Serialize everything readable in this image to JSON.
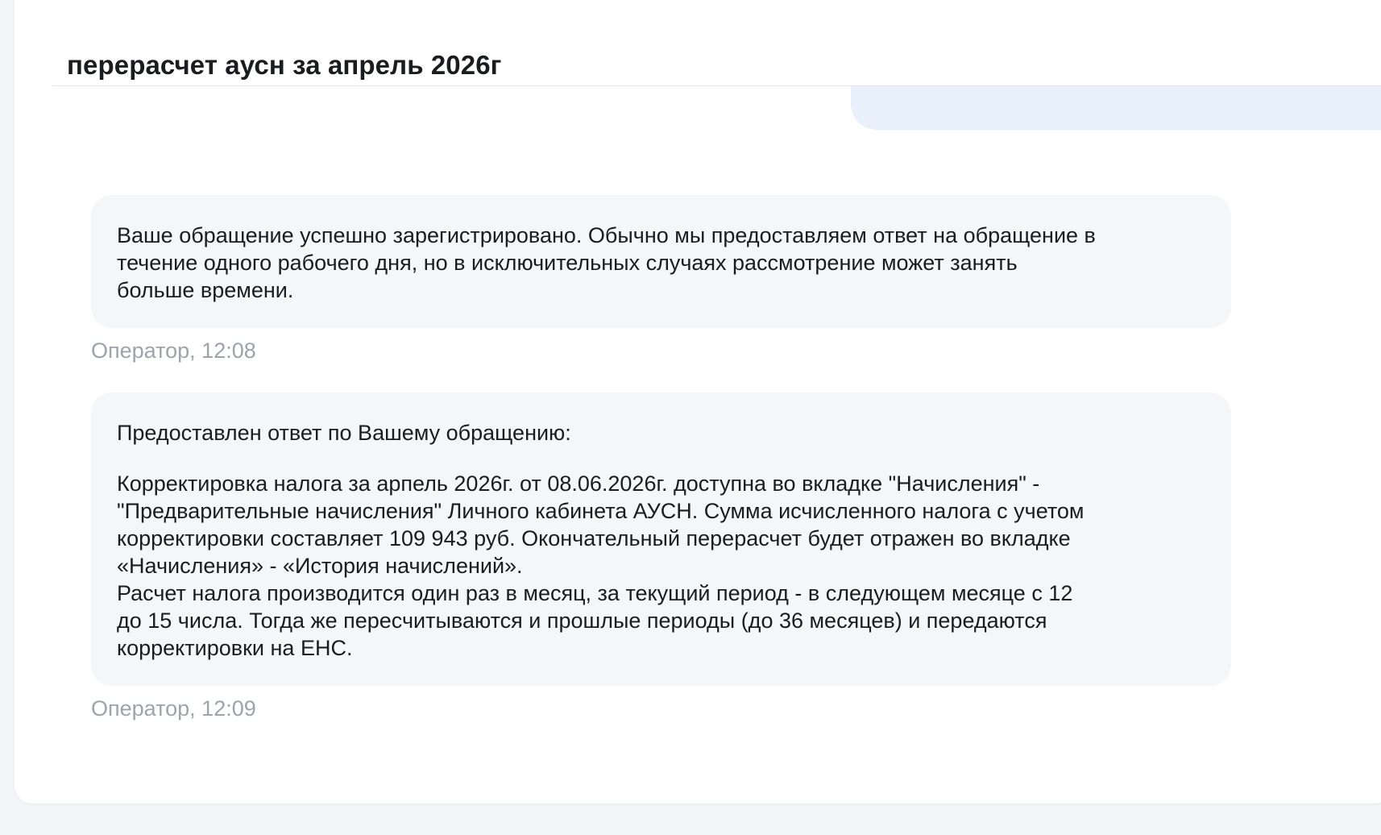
{
  "ticket": {
    "title": "перерасчет аусн за апрель 2026г"
  },
  "messages": [
    {
      "paragraphs": [
        "Ваше обращение успешно зарегистрировано. Обычно мы предоставляем ответ на обращение в\nтечение одного рабочего дня, но в исключительных случаях рассмотрение может занять\nбольше времени."
      ],
      "author_time": "Оператор, 12:08"
    },
    {
      "paragraphs": [
        "Предоставлен ответ по Вашему обращению:",
        "Корректировка налога за арпель 2026г. от 08.06.2026г. доступна во вкладке \"Начисления\" -\n\"Предварительные начисления\" Личного кабинета АУСН. Сумма исчисленного налога с учетом\nкорректировки составляет 109 943 руб. Окончательный перерасчет будет отражен во вкладке\n«Начисления» - «История начислений».\nРасчет налога производится один раз в месяц, за текущий период - в следующем месяце с 12\nдо 15 числа. Тогда же пересчитываются и прошлые периоды (до 36 месяцев) и передаются\nкорректировки на ЕНС."
      ],
      "author_time": "Оператор, 12:09"
    }
  ],
  "colors": {
    "page_background": "#f3f5f9",
    "card_background": "#ffffff",
    "operator_bubble": "#f5f6f8",
    "user_bubble": "#e8f0fb",
    "meta_text": "#9ea3ab",
    "text": "#1b1c1f"
  }
}
